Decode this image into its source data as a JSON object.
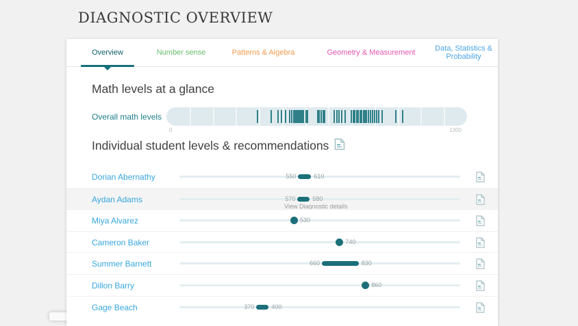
{
  "page": {
    "title": "DIAGNOSTIC OVERVIEW"
  },
  "tabs": [
    {
      "id": "overview",
      "label": "Overview",
      "color": "#0e5f68",
      "active": true
    },
    {
      "id": "number-sense",
      "label": "Number sense",
      "color": "#69bd6d",
      "active": false
    },
    {
      "id": "patterns-algebra",
      "label": "Patterns & Algebra",
      "color": "#f09a4e",
      "active": false
    },
    {
      "id": "geometry-measurement",
      "label": "Geometry & Measurement",
      "color": "#e455af",
      "active": false
    },
    {
      "id": "data-statistics-probability",
      "label": "Data, Statistics & Probability",
      "color": "#4ba5e4",
      "active": false
    }
  ],
  "glance": {
    "heading": "Math levels at a glance",
    "row_label": "Overall math levels",
    "axis_min": "0",
    "axis_max": "1300"
  },
  "chart_data": {
    "type": "strip",
    "title": "Overall math levels",
    "xlabel": "",
    "xlim": [
      0,
      1300
    ],
    "values": [
      390,
      449,
      480,
      495,
      513,
      530,
      540,
      548,
      554,
      560,
      566,
      571,
      576,
      582,
      590,
      600,
      608,
      650,
      658,
      666,
      674,
      682,
      724,
      733,
      742,
      754,
      769,
      797,
      806,
      812,
      820,
      827,
      835,
      842,
      849,
      856,
      863,
      871,
      880,
      889,
      897,
      906,
      915,
      931,
      988,
      1018
    ]
  },
  "students": {
    "heading": "Individual student levels & recommendations",
    "tooltip": "View Diagnostic details",
    "scale_min": 0,
    "scale_max": 1300,
    "rows": [
      {
        "name": "Dorian Abernathy",
        "low": 550,
        "high": 610,
        "hovered": false
      },
      {
        "name": "Aydan Adams",
        "low": 570,
        "high": 580,
        "hovered": true
      },
      {
        "name": "Miya Alvarez",
        "low": 530,
        "high": 530,
        "hovered": false
      },
      {
        "name": "Cameron Baker",
        "low": 740,
        "high": 740,
        "hovered": false
      },
      {
        "name": "Summer Barnett",
        "low": 660,
        "high": 830,
        "hovered": false
      },
      {
        "name": "Dillon Barry",
        "low": 860,
        "high": 860,
        "hovered": false
      },
      {
        "name": "Gage Beach",
        "low": 370,
        "high": 400,
        "hovered": false
      }
    ]
  },
  "colors": {
    "accent_teal": "#1b707a",
    "link_blue": "#36a6dd",
    "strip_bg": "#dfeaee"
  }
}
